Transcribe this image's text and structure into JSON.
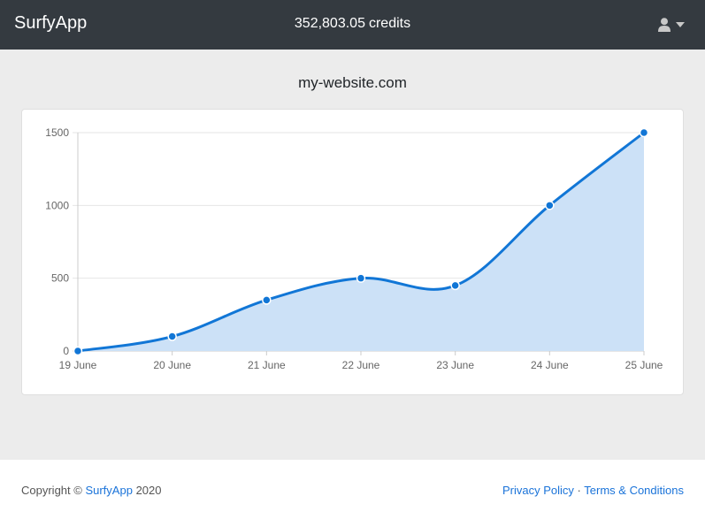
{
  "app": {
    "brand": "SurfyApp"
  },
  "header": {
    "credits_value": "352,803.05",
    "credits_label": "credits",
    "user_icon": "user-icon",
    "menu_icon": "caret-down-icon"
  },
  "main": {
    "site_title": "my-website.com"
  },
  "colors": {
    "navbar": "#343a40",
    "line": "#1176d6",
    "fill": "#cce1f7",
    "link": "#1a73d9"
  },
  "chart_data": {
    "type": "area",
    "categories": [
      "19 June",
      "20 June",
      "21 June",
      "22 June",
      "23 June",
      "24 June",
      "25 June"
    ],
    "series": [
      {
        "values": [
          0,
          100,
          350,
          500,
          450,
          1000,
          1500
        ]
      }
    ],
    "yticks": [
      "0",
      "500",
      "1000",
      "1500"
    ],
    "ylim": [
      0,
      1500
    ],
    "grid": true,
    "smooth": true
  },
  "footer": {
    "copyright_prefix": "Copyright ©",
    "copyright_link": "SurfyApp",
    "copyright_year": "2020",
    "privacy": "Privacy Policy",
    "separator": "·",
    "terms": "Terms & Conditions"
  }
}
